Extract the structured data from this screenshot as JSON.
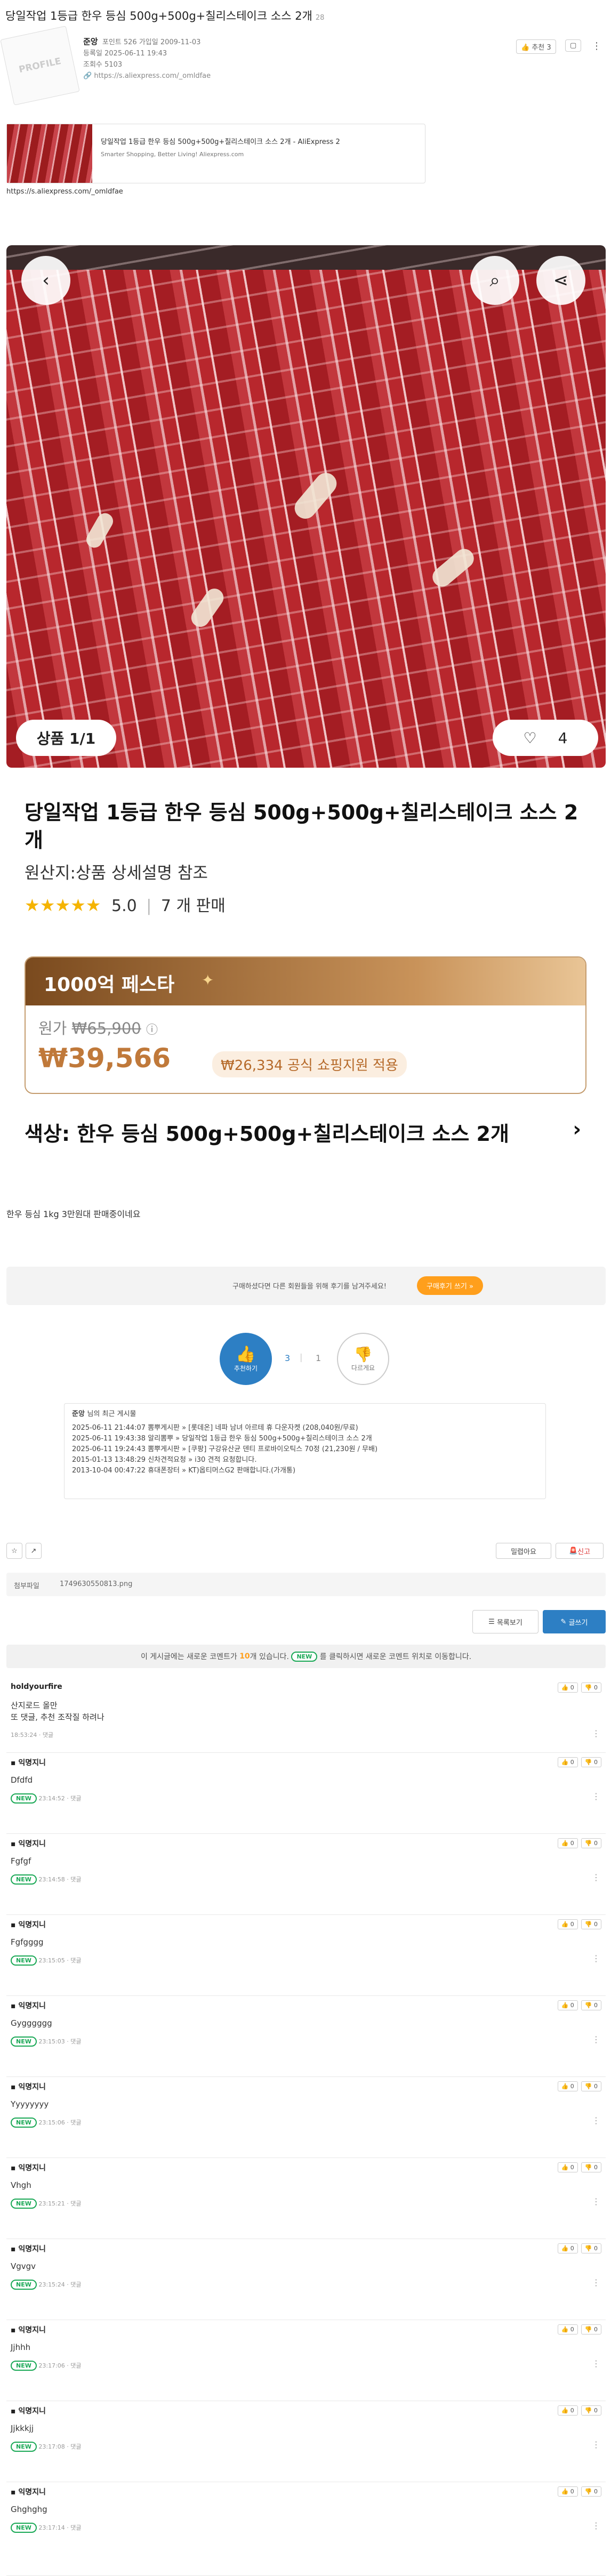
{
  "post": {
    "title": "당일작업 1등급 한우 등심 500g+500g+칠리스테이크 소스 2개",
    "title_suffix": "28",
    "author": "준앙",
    "author_info": "포인트 526 가입일 2009-11-03",
    "registered": "등록일 2025-06-11 19:43",
    "views": "조회수 5103",
    "link": "https://s.aliexpress.com/_omldfae",
    "like_btn": "추천 3",
    "avatar_text": "PROFILE"
  },
  "link_card": {
    "title": "당일작업 1등급 한우 등심 500g+500g+칠리스테이크 소스 2개 - AliExpress 2",
    "desc": "Smarter Shopping, Better Living! Aliexpress.com",
    "url_below": "https://s.aliexpress.com/_omldfae"
  },
  "product": {
    "counter": "상품 1/1",
    "likes": "4",
    "name": "당일작업 1등급 한우 등심 500g+500g+칠리스테이크 소스 2개",
    "origin": "원산지:상품 상세설명 참조",
    "rating": "5.0",
    "sold": "7 개 판매",
    "promo_banner": "1000억 페스타",
    "orig_price_label": "원가",
    "orig_price": "₩65,900",
    "price": "₩39,566",
    "discount": "₩26,334 공식 쇼핑지원 적용",
    "option": "색상: 한우 등심 500g+500g+칠리스테이크 소스 2개"
  },
  "body_text": "한우 등심 1kg 3만원대 판매중이네요",
  "review_notice": {
    "text": "구매하셨다면 다른 회원들을 위해 후기를 남겨주세요!",
    "button": "구매후기 쓰기 »"
  },
  "votes": {
    "up_label": "추천하기",
    "up_count": "3",
    "down_count": "1",
    "down_label": "다르게요"
  },
  "recent_posts": {
    "header_name": "준앙",
    "header_rest": "님의 최근 게시물",
    "items": [
      "2025-06-11 21:44:07  뽐뿌게시판 » [롯데온] 네파 남녀 아르테 휴 다운자켓 (208,040원/무료)",
      "2025-06-11 19:43:38  알리뽐뿌 » 당일작업 1등급 한우 등심 500g+500g+칠리스테이크 소스 2개",
      "2025-06-11 19:24:43  뽐뿌게시판 » [쿠팡] 구강유산균 덴티 프로바이오틱스 70정 (21,230원 / 무배)",
      "2015-01-13 13:48:29  신차견적요청 » i30 견적 요청합니다.",
      "2013-10-04 00:47:22  휴대폰장터 » KT)옵티머스G2 판매합니다.(가개통)"
    ]
  },
  "actions": {
    "bookmark": "☆",
    "share": "↗",
    "print": "밀렵아요",
    "report": "신고"
  },
  "attachment": {
    "label": "첨부파일",
    "file": "1749630550813.png"
  },
  "list_btns": {
    "list": "목록보기",
    "write": "글쓰기"
  },
  "comment_notice": {
    "before": "이 게시글에는 새로운 코멘트가",
    "count": "10",
    "middle": "개 있습니다.",
    "new": "NEW",
    "after": "를 클릭하시면 새로운 코멘트 위치로 이동합니다."
  },
  "comments": [
    {
      "author": "holdyourfire",
      "text": "산지로드 올만\n또 댓글, 추천 조작질 하려나",
      "time": "18:53:24",
      "reply": "댓글",
      "new": false,
      "up": "0",
      "down": "0"
    },
    {
      "author": "익명지니",
      "text": "Dfdfd",
      "time": "23:14:52",
      "reply": "댓글",
      "new": true,
      "up": "0",
      "down": "0"
    },
    {
      "author": "익명지니",
      "text": "Fgfgf",
      "time": "23:14:58",
      "reply": "댓글",
      "new": true,
      "up": "0",
      "down": "0"
    },
    {
      "author": "익명지니",
      "text": "Fgfgggg",
      "time": "23:15:05",
      "reply": "댓글",
      "new": true,
      "up": "0",
      "down": "0"
    },
    {
      "author": "익명지니",
      "text": "Gygggggg",
      "time": "23:15:03",
      "reply": "댓글",
      "new": true,
      "up": "0",
      "down": "0"
    },
    {
      "author": "익명지니",
      "text": "Yyyyyyyy",
      "time": "23:15:06",
      "reply": "댓글",
      "new": true,
      "up": "0",
      "down": "0"
    },
    {
      "author": "익명지니",
      "text": "Vhgh",
      "time": "23:15:21",
      "reply": "댓글",
      "new": true,
      "up": "0",
      "down": "0"
    },
    {
      "author": "익명지니",
      "text": "Vgvgv",
      "time": "23:15:24",
      "reply": "댓글",
      "new": true,
      "up": "0",
      "down": "0"
    },
    {
      "author": "익명지니",
      "text": "Jjhhh",
      "time": "23:17:06",
      "reply": "댓글",
      "new": true,
      "up": "0",
      "down": "0"
    },
    {
      "author": "익명지니",
      "text": "Jjkkkjj",
      "time": "23:17:08",
      "reply": "댓글",
      "new": true,
      "up": "0",
      "down": "0"
    },
    {
      "author": "익명지니",
      "text": "Ghghghg",
      "time": "23:17:14",
      "reply": "댓글",
      "new": true,
      "up": "0",
      "down": "0"
    }
  ],
  "colors": {
    "accent_orange": "#ff9f1c",
    "new_green": "#19a855",
    "price_brown": "#c0793a",
    "like_blue": "#2d7fc4"
  }
}
